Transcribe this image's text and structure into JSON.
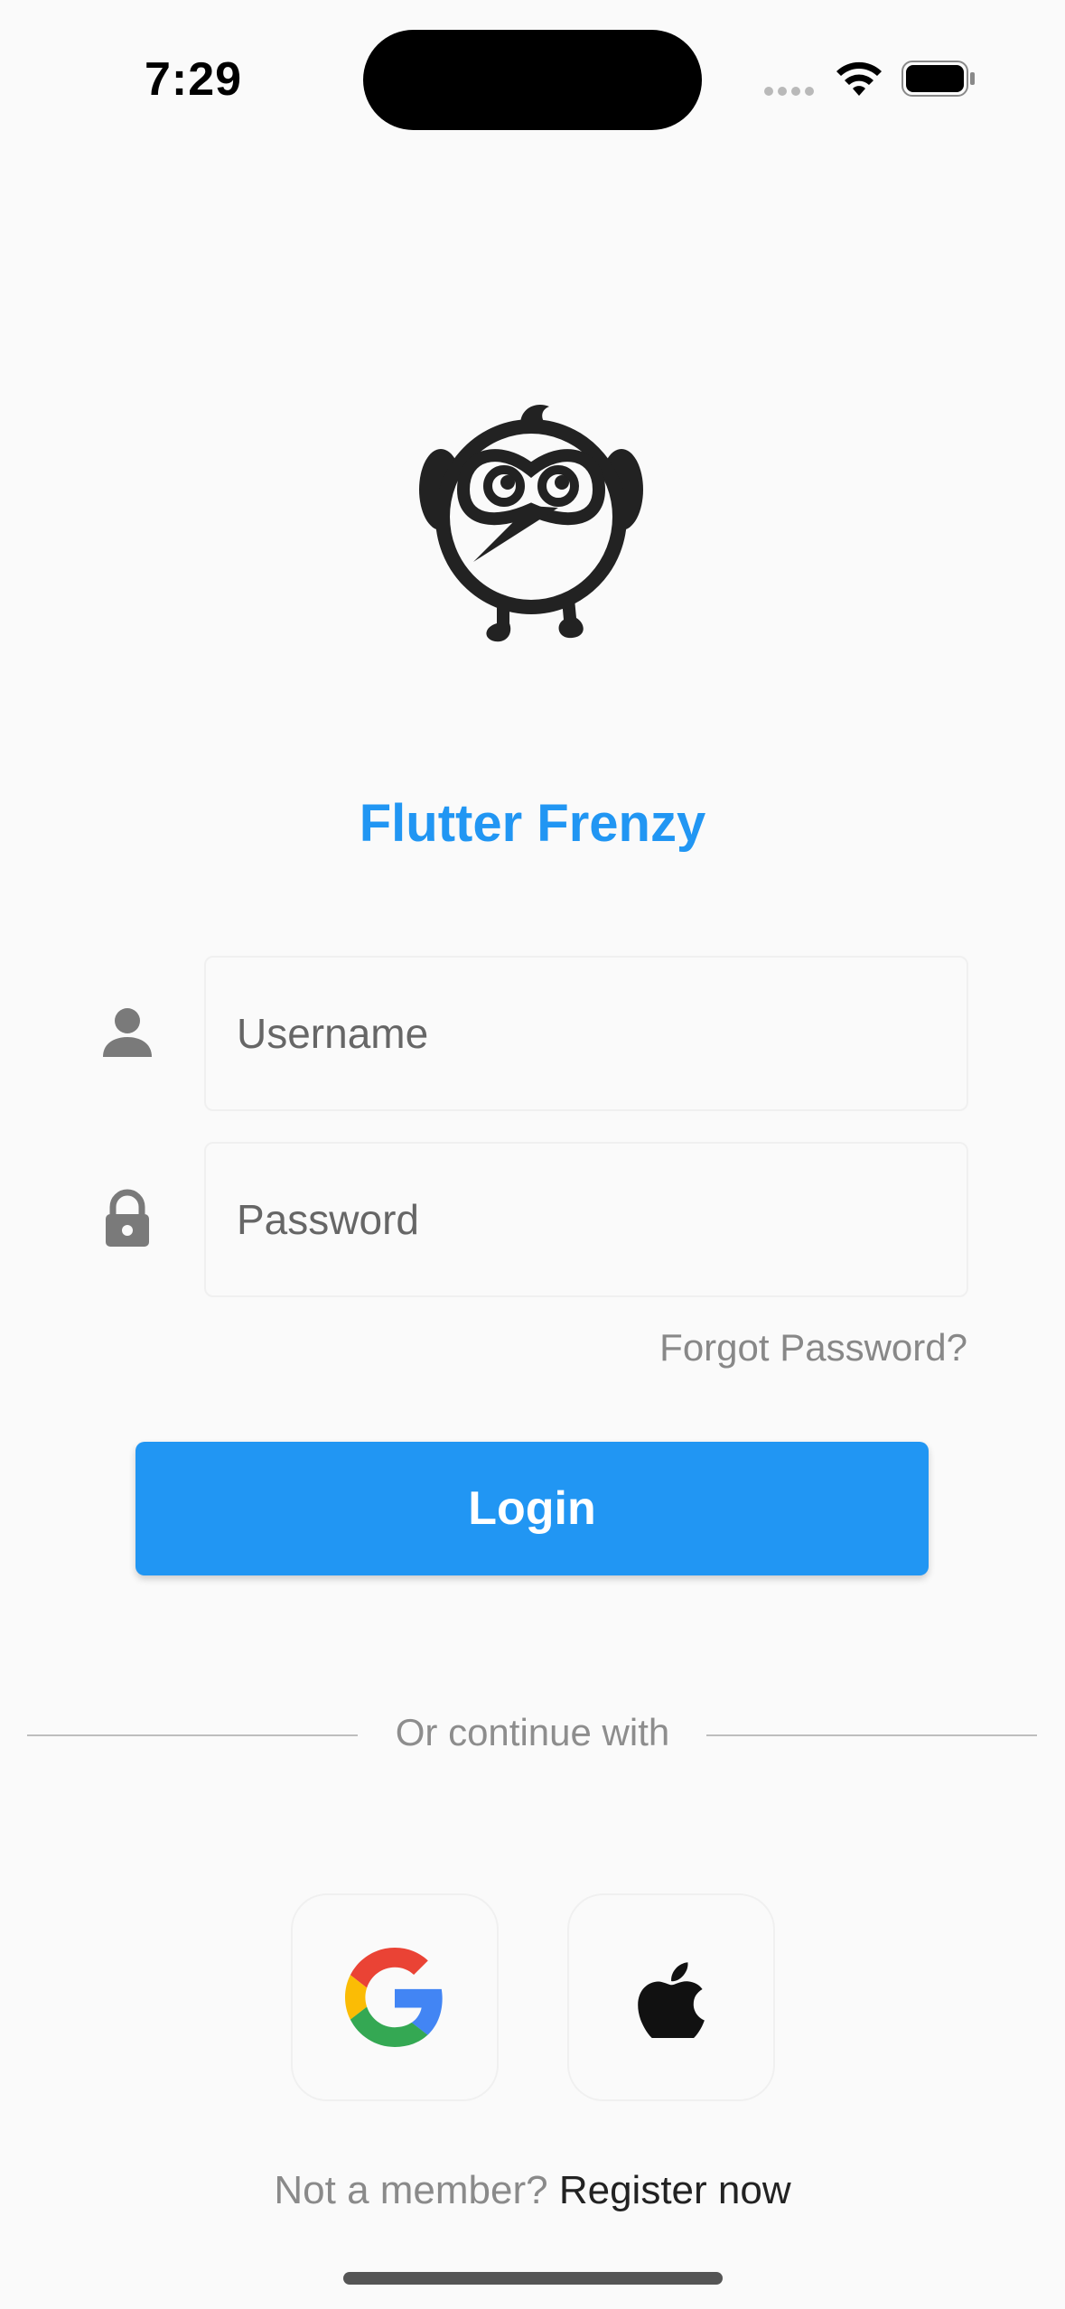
{
  "status_bar": {
    "time": "7:29"
  },
  "app": {
    "title": "Flutter Frenzy"
  },
  "form": {
    "username_placeholder": "Username",
    "password_placeholder": "Password",
    "forgot_password": "Forgot Password?",
    "login_label": "Login"
  },
  "divider": {
    "label": "Or continue with"
  },
  "social": {
    "google_icon": "google-icon",
    "apple_icon": "apple-icon"
  },
  "footer": {
    "prompt": "Not a member?",
    "register_link": "Register now"
  },
  "colors": {
    "accent": "#2196F3",
    "background": "#fafafa",
    "muted_text": "#8a8a8a",
    "icon_grey": "#7a7a7a"
  }
}
